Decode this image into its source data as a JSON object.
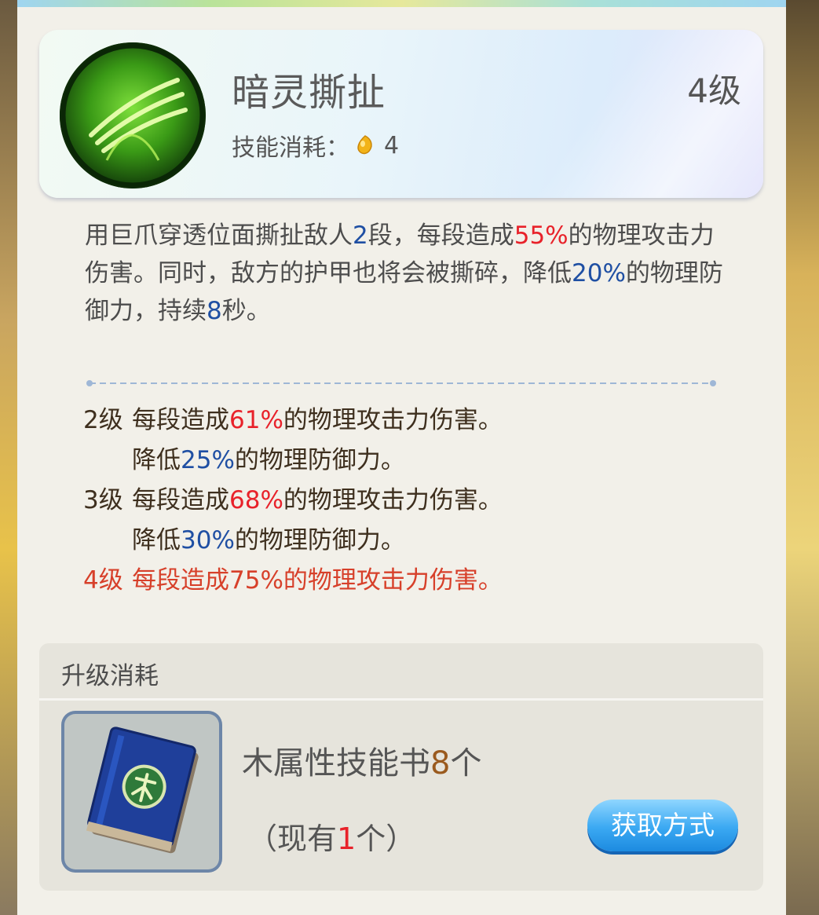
{
  "skill": {
    "name": "暗灵撕扯",
    "level": "4级",
    "cost_label": "技能消耗：",
    "cost_value": "4"
  },
  "description": {
    "p1": "用巨爪穿透位面撕扯敌人",
    "hit_count": "2",
    "p2": "段，每段造成",
    "damage_pct": "55%",
    "p3": "的物理攻击力伤害。同时，敌方的护甲也将会被撕碎，降低",
    "armor_pct": "20%",
    "p4": "的物理防御力，持续",
    "duration": "8",
    "p5": "秒。"
  },
  "levels": [
    {
      "level": "2级",
      "pre": "每段造成",
      "damage": "61%",
      "post": "的物理攻击力伤害。",
      "reduce_pre": "降低",
      "reduce": "25%",
      "reduce_post": "的物理防御力。"
    },
    {
      "level": "3级",
      "pre": "每段造成",
      "damage": "68%",
      "post": "的物理攻击力伤害。",
      "reduce_pre": "降低",
      "reduce": "30%",
      "reduce_post": "的物理防御力。"
    },
    {
      "level": "4级",
      "pre": "每段造成",
      "damage": "75%",
      "post": "的物理攻击力伤害。"
    }
  ],
  "upgrade": {
    "title": "升级消耗",
    "item_name": "木属性技能书",
    "item_count": "8",
    "item_unit": "个",
    "own_pre": "（现有",
    "own_count": "1",
    "own_post": "个）",
    "button_label": "获取方式"
  },
  "colors": {
    "highlight_red": "#e8222a",
    "highlight_blue": "#1f4fa3",
    "current_level": "#d7402a",
    "button_blue": "#3aa8f2"
  }
}
